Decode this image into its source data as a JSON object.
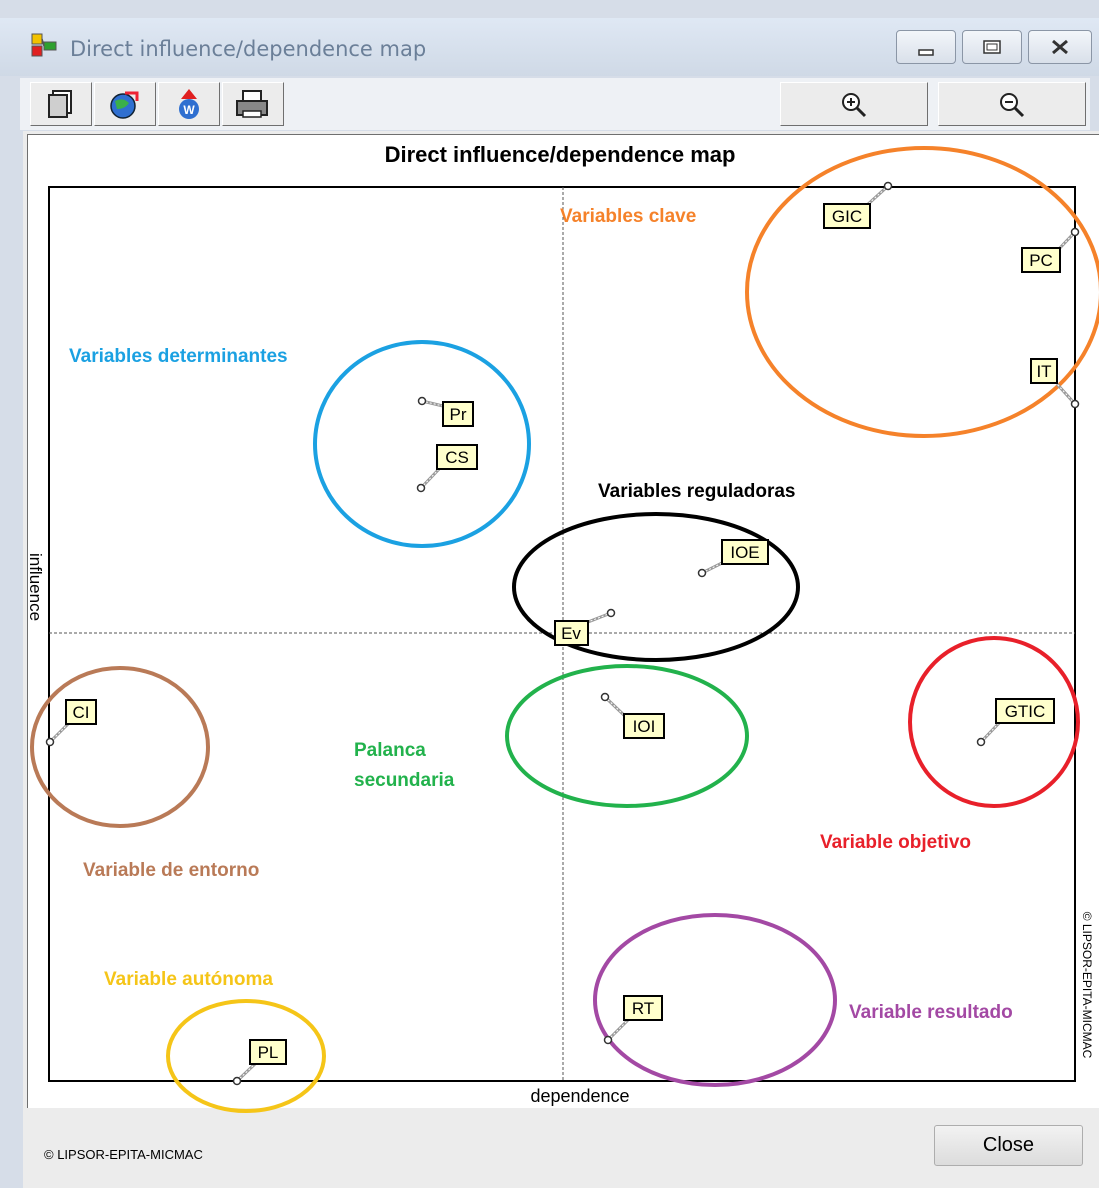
{
  "window": {
    "title": "Direct influence/dependence map",
    "close_label": "Close",
    "footer": "© LIPSOR-EPITA-MICMAC",
    "controls": [
      "minimize-icon",
      "maximize-icon",
      "close-icon"
    ]
  },
  "toolbar": {
    "buttons": [
      "copy-icon",
      "export-icon",
      "word-export-icon",
      "print-icon"
    ],
    "zoom_in_icon": "zoom-in-icon",
    "zoom_out_icon": "zoom-out-icon"
  },
  "map": {
    "title": "Direct influence/dependence map",
    "xlabel": "dependence",
    "ylabel": "influence",
    "copyright": "© LIPSOR-EPITA-MICMAC",
    "variables": [
      "GIC",
      "PC",
      "IT",
      "Pr",
      "CS",
      "IOE",
      "Ev",
      "CI",
      "IOI",
      "GTIC",
      "RT",
      "PL"
    ],
    "groups": [
      {
        "label": "Variables clave",
        "color": "#f5822a",
        "members": [
          "GIC",
          "PC",
          "IT"
        ]
      },
      {
        "label": "Variables determinantes",
        "color": "#1ba1e2",
        "members": [
          "Pr",
          "CS"
        ]
      },
      {
        "label": "Variables reguladoras",
        "color": "#000000",
        "members": [
          "IOE",
          "Ev"
        ]
      },
      {
        "label": "Palanca secundaria",
        "color": "#22b24c",
        "members": [
          "IOI"
        ]
      },
      {
        "label": "Variable objetivo",
        "color": "#e8202a",
        "members": [
          "GTIC"
        ]
      },
      {
        "label": "Variable de entorno",
        "color": "#b97a57",
        "members": [
          "CI"
        ]
      },
      {
        "label": "Variable autónoma",
        "color": "#f5c518",
        "members": [
          "PL"
        ]
      },
      {
        "label": "Variable resultado",
        "color": "#a349a4",
        "members": [
          "RT"
        ]
      }
    ],
    "palanca_line1": "Palanca",
    "palanca_line2": "secundaria"
  }
}
